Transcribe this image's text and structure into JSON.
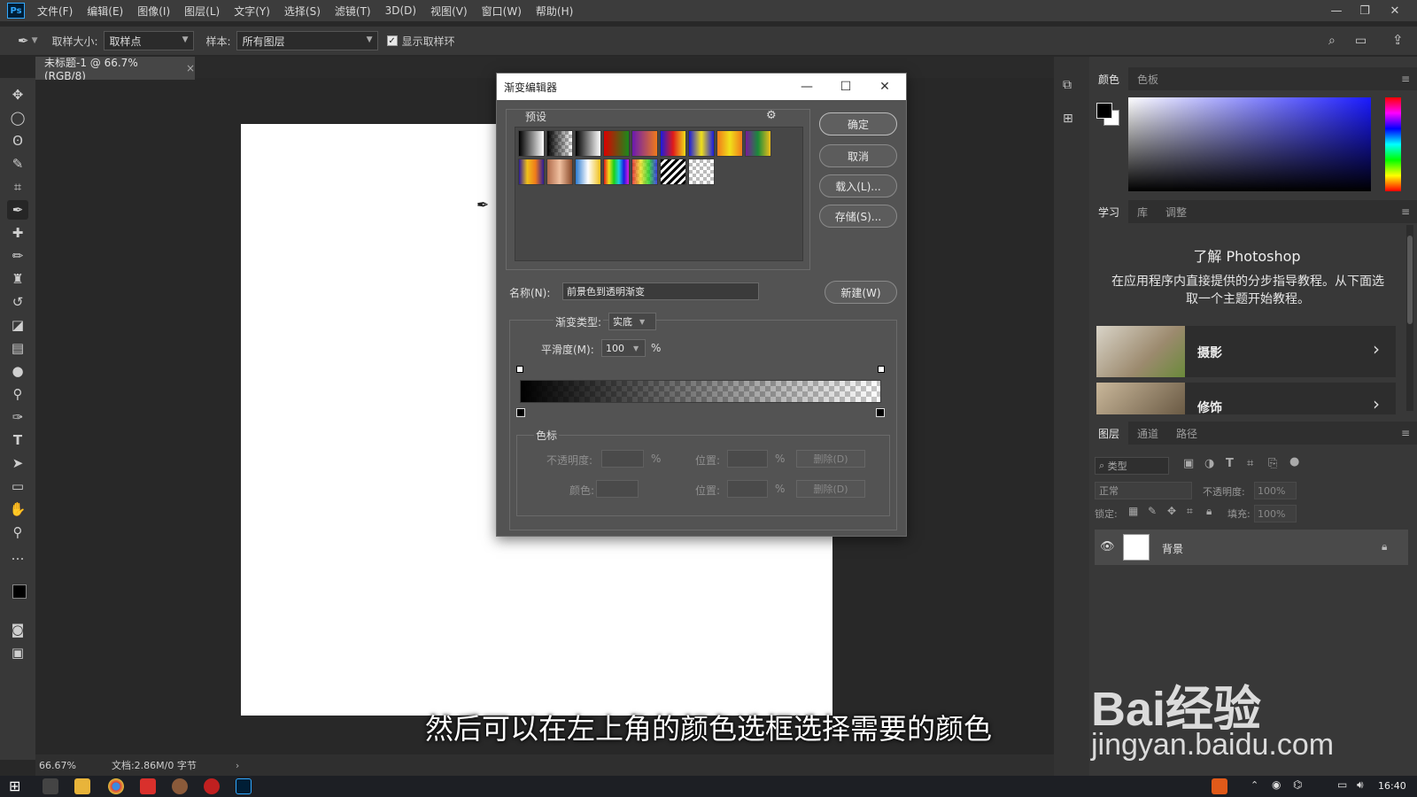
{
  "menubar": {
    "app_logo": "Ps",
    "items": [
      "文件(F)",
      "编辑(E)",
      "图像(I)",
      "图层(L)",
      "文字(Y)",
      "选择(S)",
      "滤镜(T)",
      "3D(D)",
      "视图(V)",
      "窗口(W)",
      "帮助(H)"
    ]
  },
  "options_bar": {
    "sample_size_label": "取样大小:",
    "sample_size_value": "取样点",
    "sample_label": "样本:",
    "sample_value": "所有图层",
    "show_ring_label": "显示取样环"
  },
  "document": {
    "tab_title": "未标题-1 @ 66.7%(RGB/8)",
    "close_glyph": "×"
  },
  "status": {
    "zoom": "66.67%",
    "doc_info": "文档:2.86M/0 字节",
    "arrow": "›"
  },
  "dialog": {
    "title": "渐变编辑器",
    "presets_label": "预设",
    "ok": "确定",
    "cancel": "取消",
    "load": "载入(L)...",
    "save": "存储(S)...",
    "name_label": "名称(N):",
    "name_value": "前景色到透明渐变",
    "new_button": "新建(W)",
    "type_label": "渐变类型:",
    "type_value": "实底",
    "smooth_label": "平滑度(M):",
    "smooth_value": "100",
    "percent": "%",
    "stops_label": "色标",
    "opacity_label": "不透明度:",
    "position_label": "位置:",
    "delete_label": "删除(D)",
    "color_label": "颜色:"
  },
  "color_panel": {
    "tabs": [
      "颜色",
      "色板"
    ],
    "accent": "#1a1aff"
  },
  "learn_panel": {
    "tabs": [
      "学习",
      "库",
      "调整"
    ],
    "title": "了解 Photoshop",
    "description": "在应用程序内直接提供的分步指导教程。从下面选取一个主题开始教程。",
    "cards": [
      {
        "label": "摄影"
      },
      {
        "label": "修饰"
      }
    ]
  },
  "layers_panel": {
    "tabs": [
      "图层",
      "通道",
      "路径"
    ],
    "filter_placeholder": "类型",
    "blend_mode": "正常",
    "opacity_label": "不透明度:",
    "opacity_value": "100%",
    "lock_label": "锁定:",
    "fill_label": "填充:",
    "fill_value": "100%",
    "layer_name": "背景"
  },
  "taskbar": {
    "time": "16:40"
  },
  "overlay": {
    "subtitle": "然后可以在左上角的颜色选框选择需要的颜色",
    "watermark_logo": "Bai经验",
    "watermark_url": "jingyan.baidu.com"
  }
}
